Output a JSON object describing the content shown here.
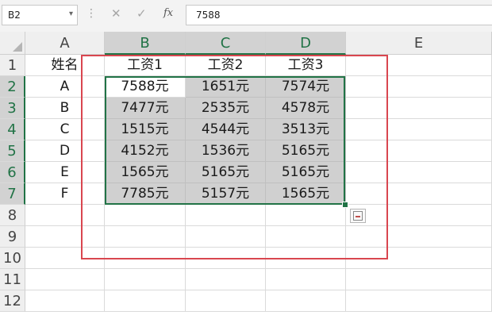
{
  "formula_bar": {
    "name_box": "B2",
    "name_box_caret": "▾",
    "dots": "⋮",
    "cancel_icon": "✕",
    "enter_icon": "✓",
    "fx_label": "fx",
    "formula_value": "7588"
  },
  "columns": [
    "A",
    "B",
    "C",
    "D",
    "E"
  ],
  "rows": [
    "1",
    "2",
    "3",
    "4",
    "5",
    "6",
    "7",
    "8",
    "9",
    "10",
    "11",
    "12"
  ],
  "grid": {
    "header": [
      "姓名",
      "工资1",
      "工资2",
      "工资3"
    ],
    "data": [
      [
        "A",
        "7588元",
        "1651元",
        "7574元"
      ],
      [
        "B",
        "7477元",
        "2535元",
        "4578元"
      ],
      [
        "C",
        "1515元",
        "4544元",
        "3513元"
      ],
      [
        "D",
        "4152元",
        "1536元",
        "5165元"
      ],
      [
        "E",
        "1565元",
        "5165元",
        "5165元"
      ],
      [
        "F",
        "7785元",
        "5157元",
        "1565元"
      ]
    ]
  },
  "selection": {
    "active_cell": "B2",
    "range": "B2:D7"
  },
  "colors": {
    "selection_green": "#217346",
    "highlight_gray": "#d0d0d0",
    "annotation_red": "#d9464f"
  }
}
